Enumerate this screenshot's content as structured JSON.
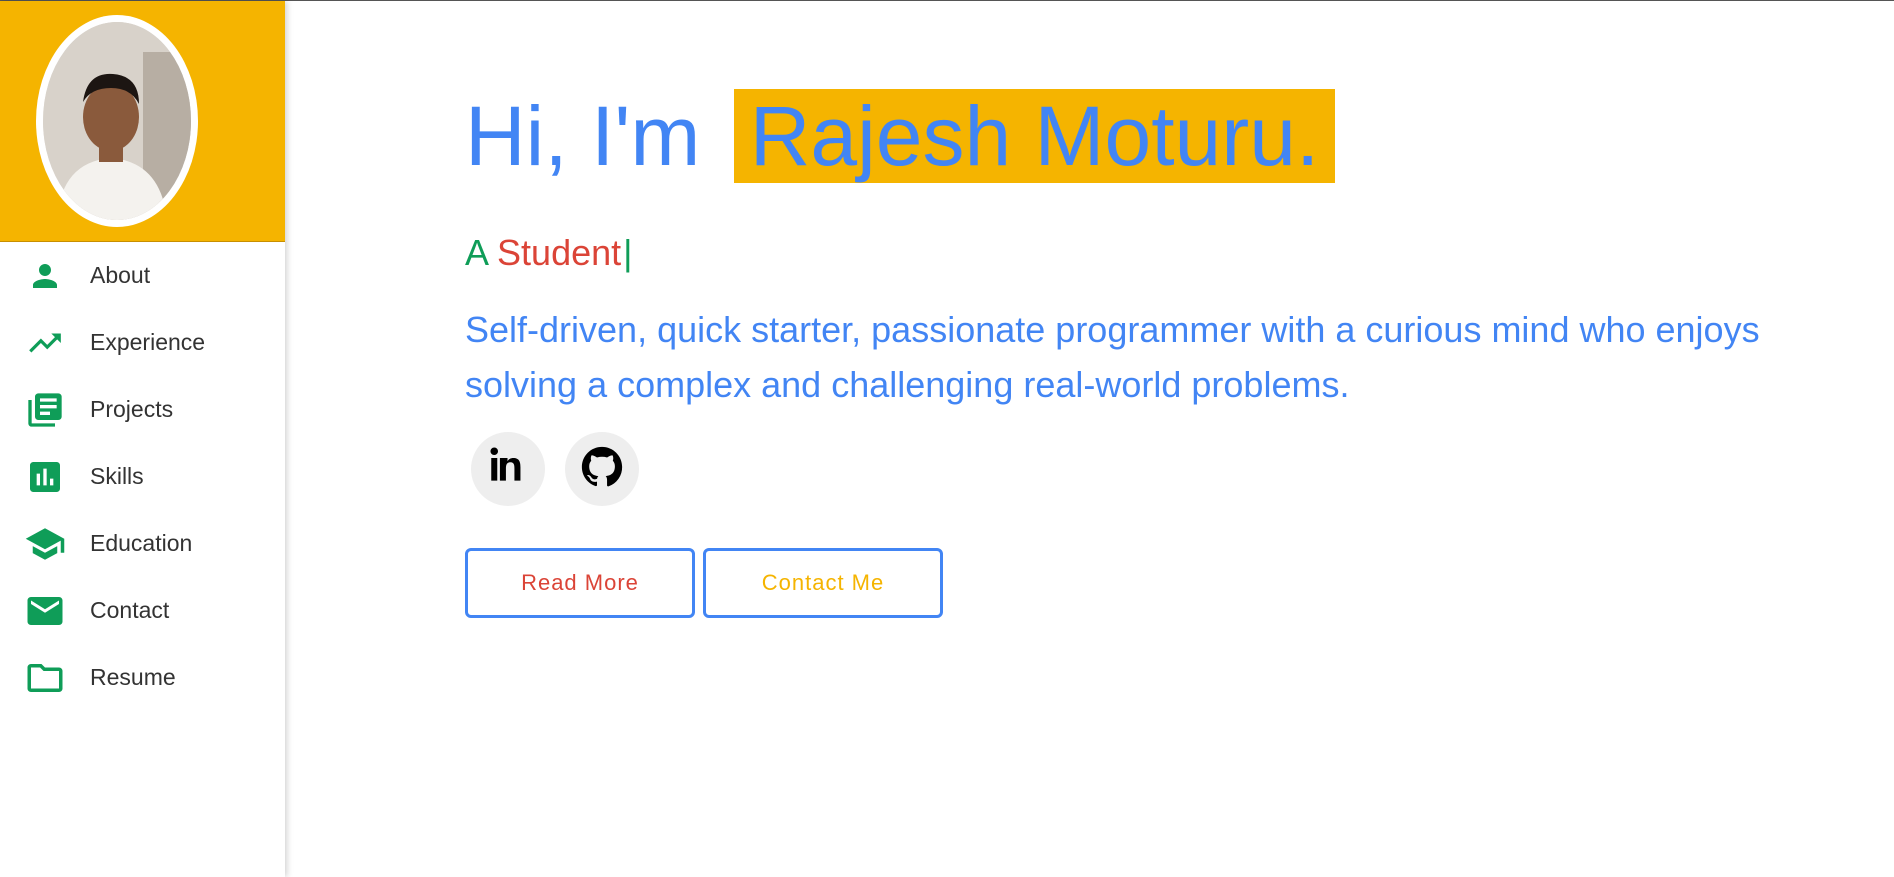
{
  "colors": {
    "yellow": "#f5b400",
    "blue": "#4285f4",
    "green": "#0f9d58",
    "red": "#db4437"
  },
  "sidebar": {
    "avatar_icon": "profile-photo",
    "items": [
      {
        "label": "About",
        "icon": "person-icon"
      },
      {
        "label": "Experience",
        "icon": "trending-up-icon"
      },
      {
        "label": "Projects",
        "icon": "library-books-icon"
      },
      {
        "label": "Skills",
        "icon": "bar-chart-icon"
      },
      {
        "label": "Education",
        "icon": "graduation-cap-icon"
      },
      {
        "label": "Contact",
        "icon": "mail-icon"
      },
      {
        "label": "Resume",
        "icon": "folder-icon"
      }
    ]
  },
  "hero": {
    "greeting": "Hi, I'm",
    "name": "Rajesh Moturu.",
    "role_prefix": "A",
    "role_word": "Student",
    "caret": "|",
    "bio": "Self-driven, quick starter, passionate programmer with a curious mind who enjoys solving a complex and challenging real-world problems.",
    "socials": [
      {
        "icon": "linkedin-icon"
      },
      {
        "icon": "github-icon"
      }
    ],
    "read_more_label": "Read More",
    "contact_label": "Contact Me"
  }
}
